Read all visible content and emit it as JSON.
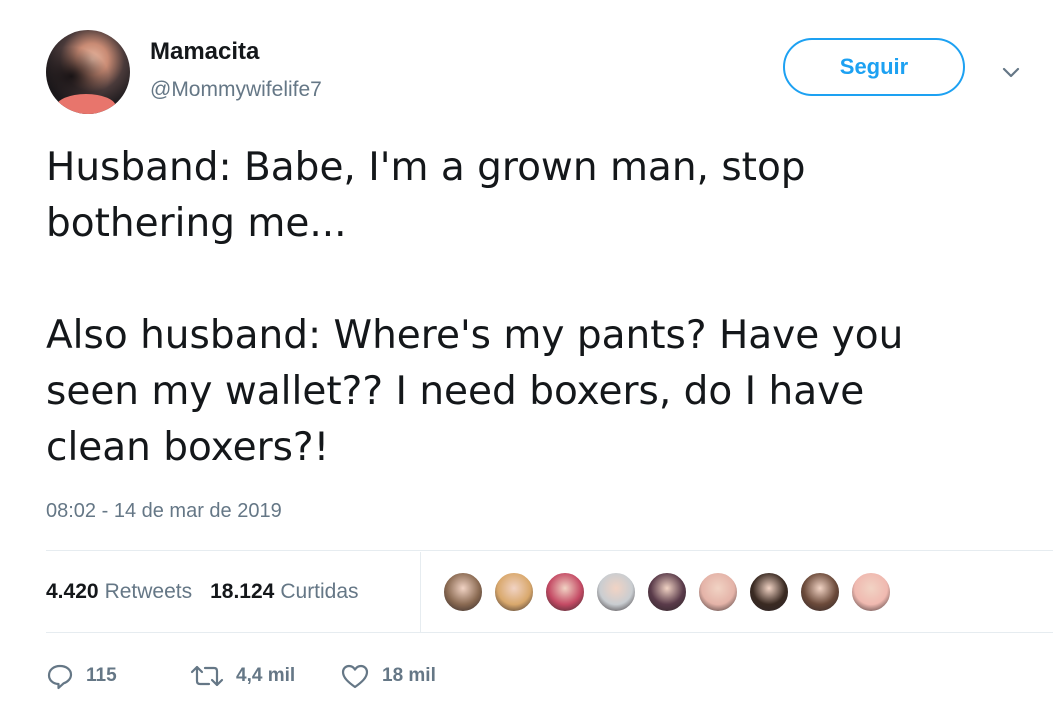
{
  "author": {
    "display_name": "Mamacita",
    "handle": "@Mommywifelife7"
  },
  "follow_button": {
    "label": "Seguir"
  },
  "tweet": {
    "text": "Husband: Babe, I'm a grown man, stop\nbothering me...\n\nAlso husband: Where's my pants? Have you\nseen my wallet?? I need boxers, do I have\nclean boxers?!",
    "timestamp": "08:02 - 14 de mar de 2019"
  },
  "stats": {
    "retweets_count": "4.420",
    "retweets_label": "Retweets",
    "likes_count": "18.124",
    "likes_label": "Curtidas"
  },
  "likers": [
    {
      "color": "#8a6a52"
    },
    {
      "color": "#d9a86c"
    },
    {
      "color": "#c44a64"
    },
    {
      "color": "#c9cdd1"
    },
    {
      "color": "#5a3b4a"
    },
    {
      "color": "#e4b3a8"
    },
    {
      "color": "#3a2a22"
    },
    {
      "color": "#6b4a3a"
    },
    {
      "color": "#f0b9b0"
    }
  ],
  "actions": {
    "replies": "115",
    "retweets": "4,4 mil",
    "likes": "18 mil"
  },
  "colors": {
    "accent": "#1da1f2",
    "secondary_text": "#657786",
    "primary_text": "#14171a",
    "divider": "#e6ecf0"
  }
}
